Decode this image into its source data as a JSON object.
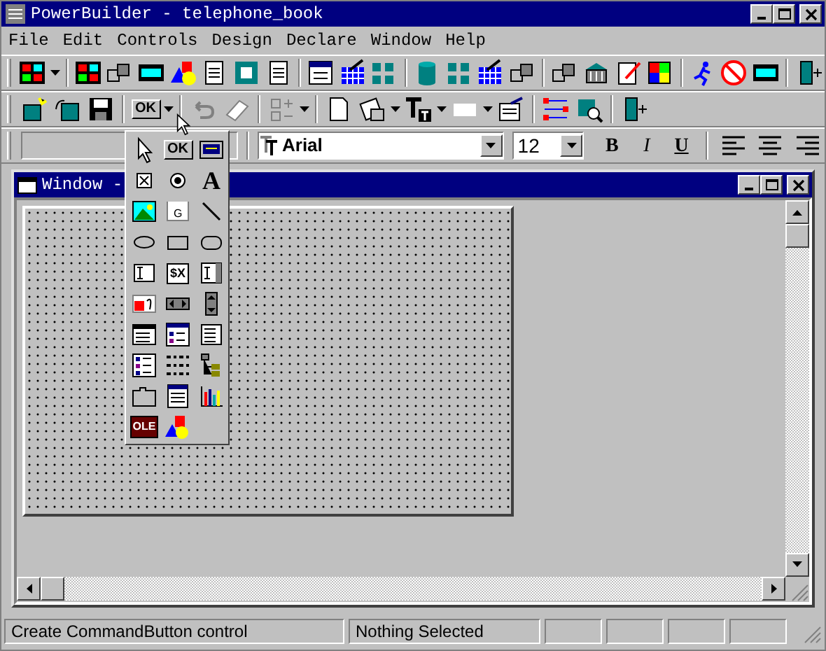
{
  "window": {
    "title": "PowerBuilder - telephone_book"
  },
  "menu": [
    {
      "label": "File"
    },
    {
      "label": "Edit"
    },
    {
      "label": "Controls"
    },
    {
      "label": "Design"
    },
    {
      "label": "Declare"
    },
    {
      "label": "Window"
    },
    {
      "label": "Help"
    }
  ],
  "toolbar": {
    "control_button": {
      "label": "OK"
    }
  },
  "style_bar": {
    "font": "Arial",
    "size": "12",
    "bold": "B",
    "italic": "I",
    "underline": "U"
  },
  "palette": {
    "items": [
      {
        "kind": "pointer"
      },
      {
        "kind": "command_button",
        "label": "OK"
      },
      {
        "kind": "picture_button"
      },
      {
        "kind": "checkbox"
      },
      {
        "kind": "radio"
      },
      {
        "kind": "static_text",
        "label": "A"
      },
      {
        "kind": "picture"
      },
      {
        "kind": "group_box",
        "label": "G"
      },
      {
        "kind": "line"
      },
      {
        "kind": "oval"
      },
      {
        "kind": "rectangle"
      },
      {
        "kind": "round_rectangle"
      },
      {
        "kind": "single_line_edit"
      },
      {
        "kind": "edit_mask",
        "label": "$X"
      },
      {
        "kind": "multi_line_edit"
      },
      {
        "kind": "rich_text"
      },
      {
        "kind": "hscroll"
      },
      {
        "kind": "vscroll"
      },
      {
        "kind": "dropdown_list"
      },
      {
        "kind": "listview"
      },
      {
        "kind": "listbox"
      },
      {
        "kind": "picture_list"
      },
      {
        "kind": "icon_grid"
      },
      {
        "kind": "tree"
      },
      {
        "kind": "tab"
      },
      {
        "kind": "datawindow"
      },
      {
        "kind": "graph"
      },
      {
        "kind": "ole",
        "label": "OLE"
      },
      {
        "kind": "user_object"
      }
    ]
  },
  "child_window": {
    "title": "Window -"
  },
  "status_bar": {
    "message": "Create CommandButton control",
    "selection": "Nothing Selected"
  }
}
